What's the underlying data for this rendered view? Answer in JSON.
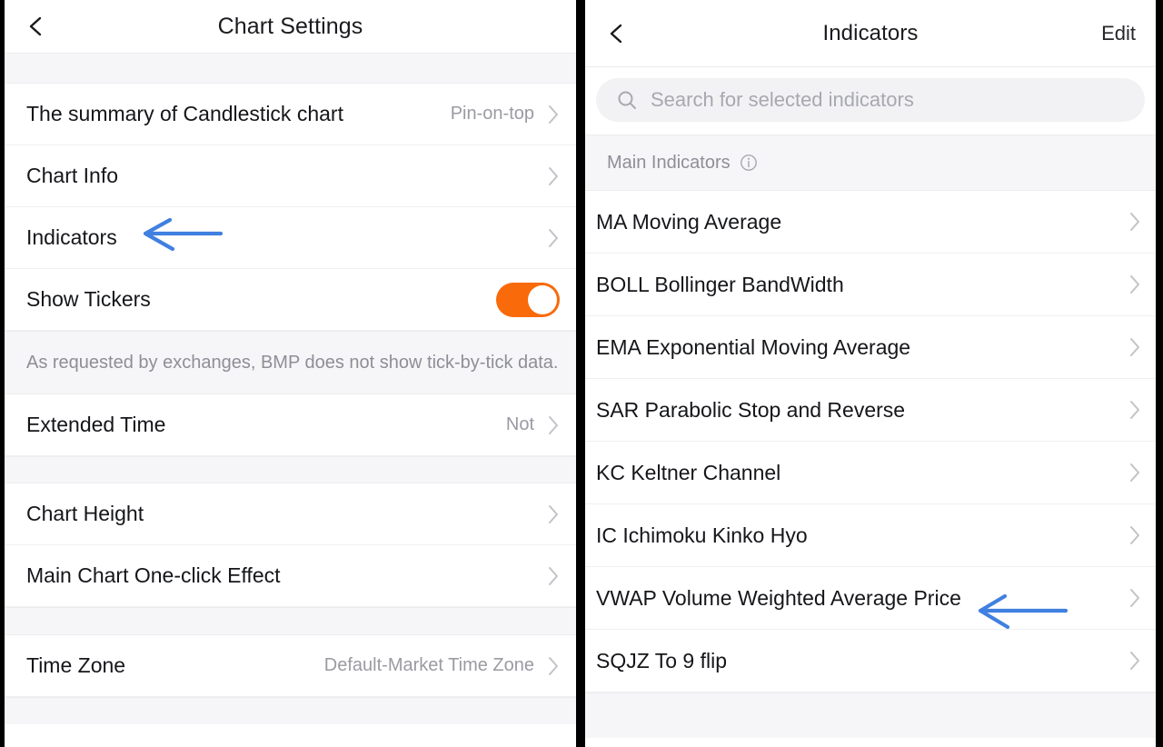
{
  "colors": {
    "accent_orange": "#f96a0a",
    "annotation_blue": "#4080e0",
    "text_primary": "#15161a",
    "text_muted": "#9a9aa2",
    "band_grey": "#f6f6f8",
    "divider_black": "#000000"
  },
  "left_panel": {
    "header": {
      "back_icon": "back-chevron-icon",
      "title": "Chart Settings"
    },
    "groups": [
      {
        "rows": [
          {
            "label": "The summary of Candlestick chart",
            "value": "Pin-on-top",
            "control": "chevron"
          },
          {
            "label": "Chart Info",
            "value": "",
            "control": "chevron"
          },
          {
            "label": "Indicators",
            "value": "",
            "control": "chevron"
          },
          {
            "label": "Show Tickers",
            "value": "",
            "control": "toggle",
            "toggle_on": true
          }
        ]
      },
      {
        "note": "As requested by exchanges, BMP does not show tick-by-tick data.",
        "rows": [
          {
            "label": "Extended Time",
            "value": "Not",
            "control": "chevron"
          }
        ]
      },
      {
        "rows": [
          {
            "label": "Chart Height",
            "value": "",
            "control": "chevron"
          },
          {
            "label": "Main Chart One-click Effect",
            "value": "",
            "control": "chevron"
          }
        ]
      },
      {
        "rows": [
          {
            "label": "Time Zone",
            "value": "Default-Market Time Zone",
            "control": "chevron"
          }
        ]
      }
    ]
  },
  "right_panel": {
    "header": {
      "back_icon": "back-chevron-icon",
      "title": "Indicators",
      "edit_label": "Edit"
    },
    "search": {
      "icon": "search-icon",
      "placeholder": "Search for selected indicators",
      "value": ""
    },
    "section": {
      "label": "Main Indicators",
      "info_icon": "info-circle-icon"
    },
    "indicators": [
      {
        "label": "MA Moving Average"
      },
      {
        "label": "BOLL Bollinger BandWidth"
      },
      {
        "label": "EMA Exponential Moving Average"
      },
      {
        "label": "SAR Parabolic Stop and Reverse"
      },
      {
        "label": "KC Keltner Channel"
      },
      {
        "label": "IC Ichimoku Kinko Hyo"
      },
      {
        "label": "VWAP Volume Weighted Average Price"
      },
      {
        "label": "SQJZ To 9 flip"
      }
    ]
  },
  "annotations": [
    {
      "name": "arrow-pointing-to-indicators-row",
      "shape": "left-arrow",
      "color": "#4080e0"
    },
    {
      "name": "arrow-pointing-to-vwap-row",
      "shape": "left-arrow",
      "color": "#4080e0"
    }
  ]
}
